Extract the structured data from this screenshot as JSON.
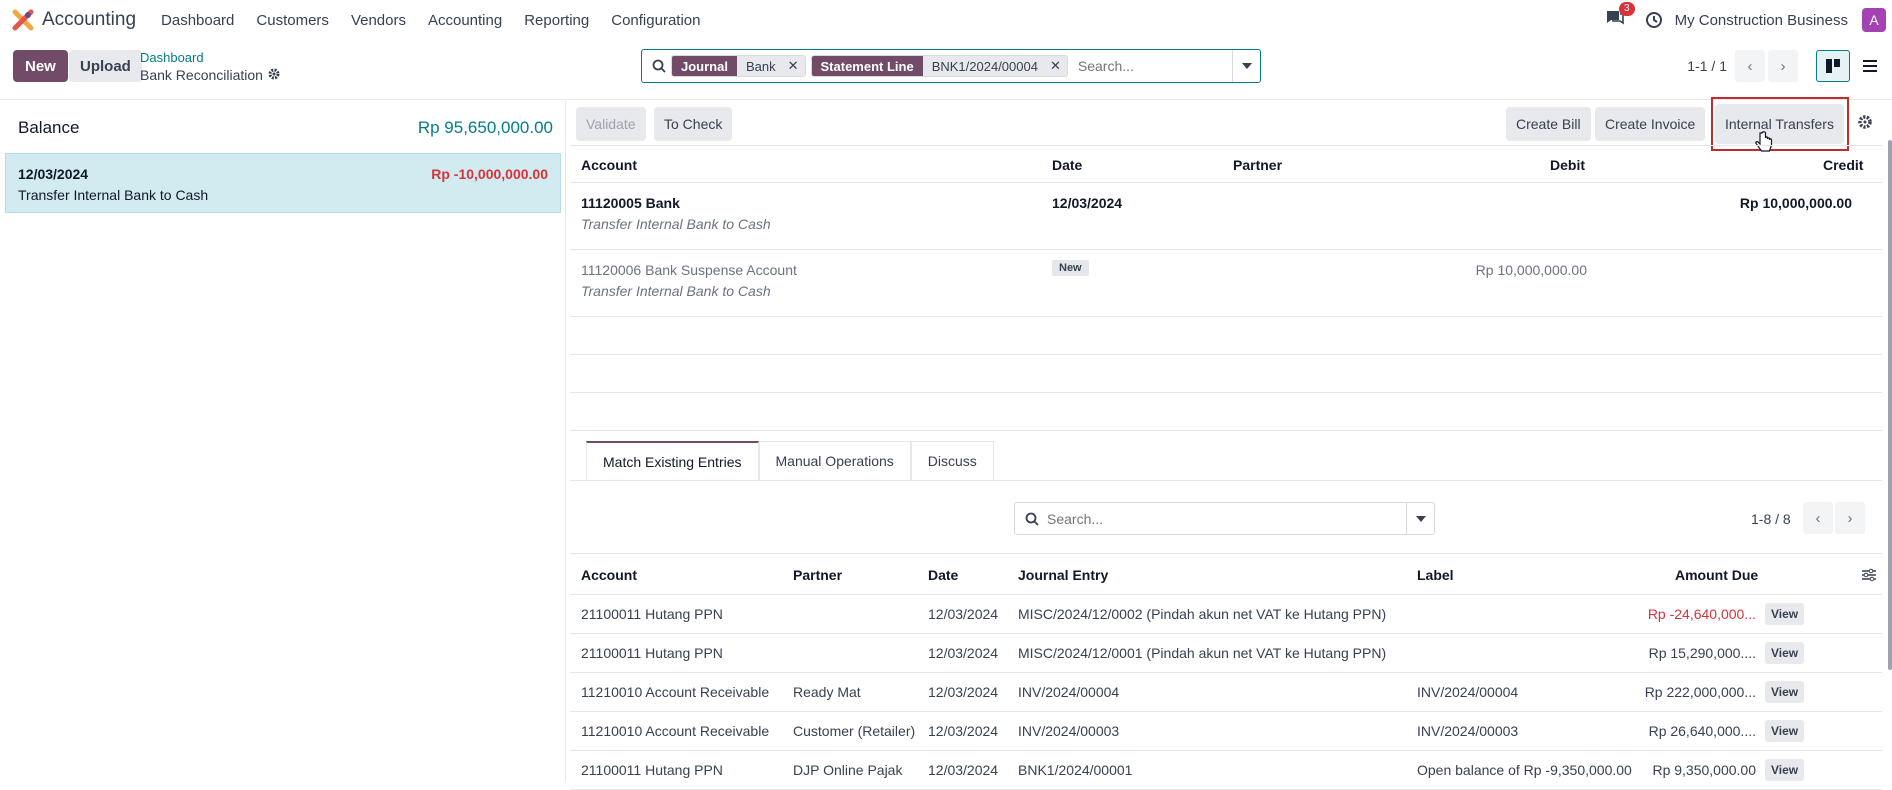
{
  "topbar": {
    "app_name": "Accounting",
    "menu": [
      "Dashboard",
      "Customers",
      "Vendors",
      "Accounting",
      "Reporting",
      "Configuration"
    ],
    "chat_count": "3",
    "company": "My Construction Business",
    "avatar": "A"
  },
  "control": {
    "new": "New",
    "upload": "Upload",
    "bc_parent": "Dashboard",
    "bc_current": "Bank Reconciliation",
    "facets": [
      {
        "label": "Journal",
        "value": "Bank"
      },
      {
        "label": "Statement Line",
        "value": "BNK1/2024/00004"
      }
    ],
    "search_placeholder": "Search...",
    "pager": "1-1 / 1"
  },
  "left": {
    "balance_label": "Balance",
    "balance": "Rp 95,650,000.00",
    "line": {
      "date": "12/03/2024",
      "label": "Transfer Internal Bank to Cash",
      "amount": "Rp -10,000,000.00"
    }
  },
  "actions": {
    "validate": "Validate",
    "to_check": "To Check",
    "create_bill": "Create Bill",
    "create_invoice": "Create Invoice",
    "internal_transfers": "Internal Transfers"
  },
  "entries": {
    "headers": {
      "account": "Account",
      "date": "Date",
      "partner": "Partner",
      "debit": "Debit",
      "credit": "Credit"
    },
    "rows": [
      {
        "account": "11120005 Bank",
        "label": "Transfer Internal Bank to Cash",
        "date": "12/03/2024",
        "debit": "",
        "credit": "Rp 10,000,000.00"
      },
      {
        "account": "11120006 Bank Suspense Account",
        "label": "Transfer Internal Bank to Cash",
        "badge": "New",
        "debit": "Rp 10,000,000.00",
        "credit": ""
      }
    ]
  },
  "tabs": [
    "Match Existing Entries",
    "Manual Operations",
    "Discuss"
  ],
  "match": {
    "search_placeholder": "Search...",
    "pager": "1-8 / 8",
    "headers": {
      "account": "Account",
      "partner": "Partner",
      "date": "Date",
      "journal_entry": "Journal Entry",
      "label": "Label",
      "amount_due": "Amount Due"
    },
    "view": "View",
    "rows": [
      {
        "account": "21100011 Hutang PPN",
        "partner": "",
        "date": "12/03/2024",
        "entry": "MISC/2024/12/0002 (Pindah akun net VAT ke Hutang PPN)",
        "label": "",
        "amount": "Rp -24,640,000...",
        "negative": true
      },
      {
        "account": "21100011 Hutang PPN",
        "partner": "",
        "date": "12/03/2024",
        "entry": "MISC/2024/12/0001 (Pindah akun net VAT ke Hutang PPN)",
        "label": "",
        "amount": "Rp 15,290,000....",
        "negative": false
      },
      {
        "account": "11210010 Account Receivable",
        "partner": "Ready Mat",
        "date": "12/03/2024",
        "entry": "INV/2024/00004",
        "label": "INV/2024/00004",
        "amount": "Rp 222,000,000...",
        "negative": false
      },
      {
        "account": "11210010 Account Receivable",
        "partner": "Customer (Retailer)",
        "date": "12/03/2024",
        "entry": "INV/2024/00003",
        "label": "INV/2024/00003",
        "amount": "Rp 26,640,000....",
        "negative": false
      },
      {
        "account": "21100011 Hutang PPN",
        "partner": "DJP Online Pajak",
        "date": "12/03/2024",
        "entry": "BNK1/2024/00001",
        "label": "Open balance of Rp -9,350,000.00",
        "amount": "Rp 9,350,000.00",
        "negative": false
      }
    ]
  }
}
